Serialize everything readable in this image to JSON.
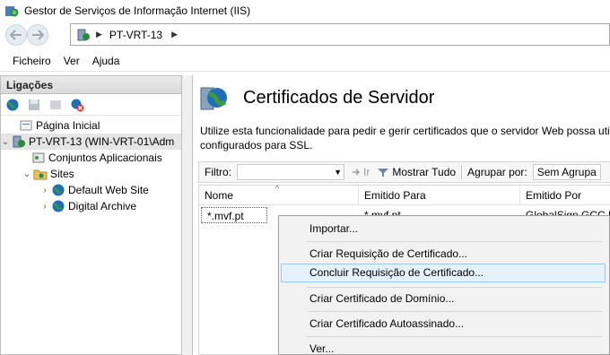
{
  "window": {
    "title": "Gestor de Serviços de Informação Internet (IIS)"
  },
  "address": {
    "crumb": "PT-VRT-13",
    "separator": "▶"
  },
  "menu": {
    "items": [
      "Ficheiro",
      "Ver",
      "Ajuda"
    ]
  },
  "connections": {
    "header": "Ligações",
    "tree": {
      "start_page": "Página Inicial",
      "server": "PT-VRT-13 (WIN-VRT-01\\Adm",
      "app_pools": "Conjuntos Aplicacionais",
      "sites": "Sites",
      "site1": "Default Web Site",
      "site2": "Digital Archive"
    }
  },
  "feature": {
    "title": "Certificados de Servidor",
    "description_line1": "Utilize esta funcionalidade para pedir e gerir certificados que o servidor Web possa utiliz",
    "description_line2": "configurados para SSL."
  },
  "filter": {
    "label": "Filtro:",
    "go_label": "Ir",
    "show_all_label": "Mostrar Tudo",
    "group_by_label": "Agrupar por:",
    "group_by_value": "Sem Agrupa"
  },
  "table": {
    "columns": [
      "Nome",
      "Emitido Para",
      "Emitido Por"
    ],
    "rows": [
      {
        "name": "*.mvf.pt",
        "issued_to": "*.mvf.pt",
        "issued_by": "GlobalSign GCC R"
      }
    ]
  },
  "context_menu": {
    "items": [
      "Importar...",
      "Criar Requisição de Certificado...",
      "Concluir Requisição de Certificado...",
      "Criar Certificado de Domínio...",
      "Criar Certificado Autoassinado...",
      "Ver..."
    ],
    "highlighted_index": 2
  },
  "colors": {
    "highlight_bg": "#e5f1fb",
    "highlight_border": "#99c9ef",
    "globe_blue": "#1f6fb5",
    "globe_green": "#3c9a3c"
  },
  "icons": [
    "iis-app-icon",
    "back-arrow-icon",
    "forward-arrow-icon",
    "server-icon",
    "globe-icon",
    "folder-icon",
    "save-icon",
    "disconnect-icon",
    "go-icon",
    "show-all-icon"
  ]
}
